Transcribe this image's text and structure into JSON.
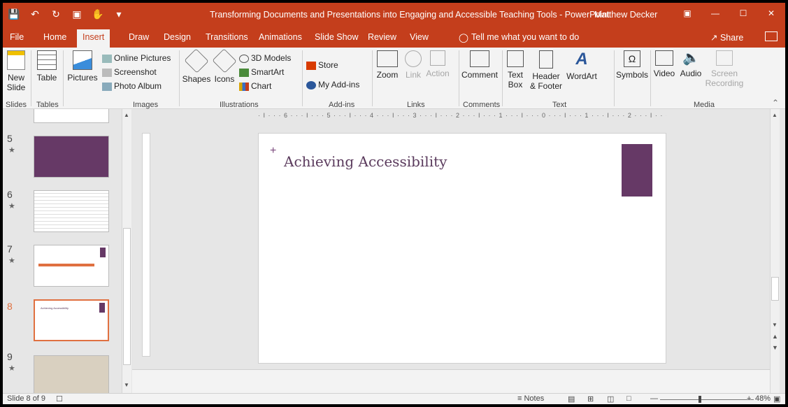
{
  "window": {
    "doc_title": "Transforming Documents and Presentations into Engaging and Accessible Teaching Tools - PowerPoint",
    "user": "Matthew Decker"
  },
  "tabs": [
    {
      "label": "File"
    },
    {
      "label": "Home"
    },
    {
      "label": "Insert"
    },
    {
      "label": "Draw"
    },
    {
      "label": "Design"
    },
    {
      "label": "Transitions"
    },
    {
      "label": "Animations"
    },
    {
      "label": "Slide Show"
    },
    {
      "label": "Review"
    },
    {
      "label": "View"
    }
  ],
  "active_tab": "Insert",
  "tell_me": "Tell me what you want to do",
  "share": "Share",
  "ribbon": {
    "new_slide": "New\nSlide",
    "table": "Table",
    "pictures": "Pictures",
    "online_pictures": "Online Pictures",
    "screenshot": "Screenshot",
    "photo_album": "Photo Album",
    "shapes": "Shapes",
    "icons": "Icons",
    "models_3d": "3D Models",
    "smartart": "SmartArt",
    "chart": "Chart",
    "store": "Store",
    "my_addins": "My Add-ins",
    "zoom": "Zoom",
    "link": "Link",
    "action": "Action",
    "comment": "Comment",
    "text_box": "Text\nBox",
    "header_footer": "Header\n& Footer",
    "wordart": "WordArt",
    "symbols": "Symbols",
    "video": "Video",
    "audio": "Audio",
    "screen_recording": "Screen\nRecording",
    "groups": {
      "slides": "Slides",
      "tables": "Tables",
      "images": "Images",
      "illustrations": "Illustrations",
      "addins": "Add-ins",
      "links": "Links",
      "comments": "Comments",
      "text": "Text",
      "media": "Media"
    }
  },
  "thumbnails": [
    {
      "num": "5",
      "star": true
    },
    {
      "num": "6",
      "star": true
    },
    {
      "num": "7",
      "star": true
    },
    {
      "num": "8",
      "star": false,
      "selected": true,
      "title": "Achieving Accessibility"
    },
    {
      "num": "9",
      "star": true
    }
  ],
  "ruler_text": "· I · · · 6 · · · I · · · 5 · · · I · · · 4 · · · I · · · 3 · · · I · · · 2 · · · I · · · 1 · · · I · · · 0 · · · I · · · 1 · · · I · · · 2 · · · I · · · 3 · · · I · · · 4 · · · I · · · 5 · · · I · · · 6 · · · I ·",
  "slide": {
    "title": "Achieving Accessibility",
    "accent_color": "#663966"
  },
  "status": {
    "slide_counter": "Slide 8 of 9",
    "notes": "Notes",
    "zoom": "48%"
  },
  "colors": {
    "brand": "#c43e1c",
    "ribbon_bg": "#f3f3f3",
    "selection": "#e07040"
  }
}
